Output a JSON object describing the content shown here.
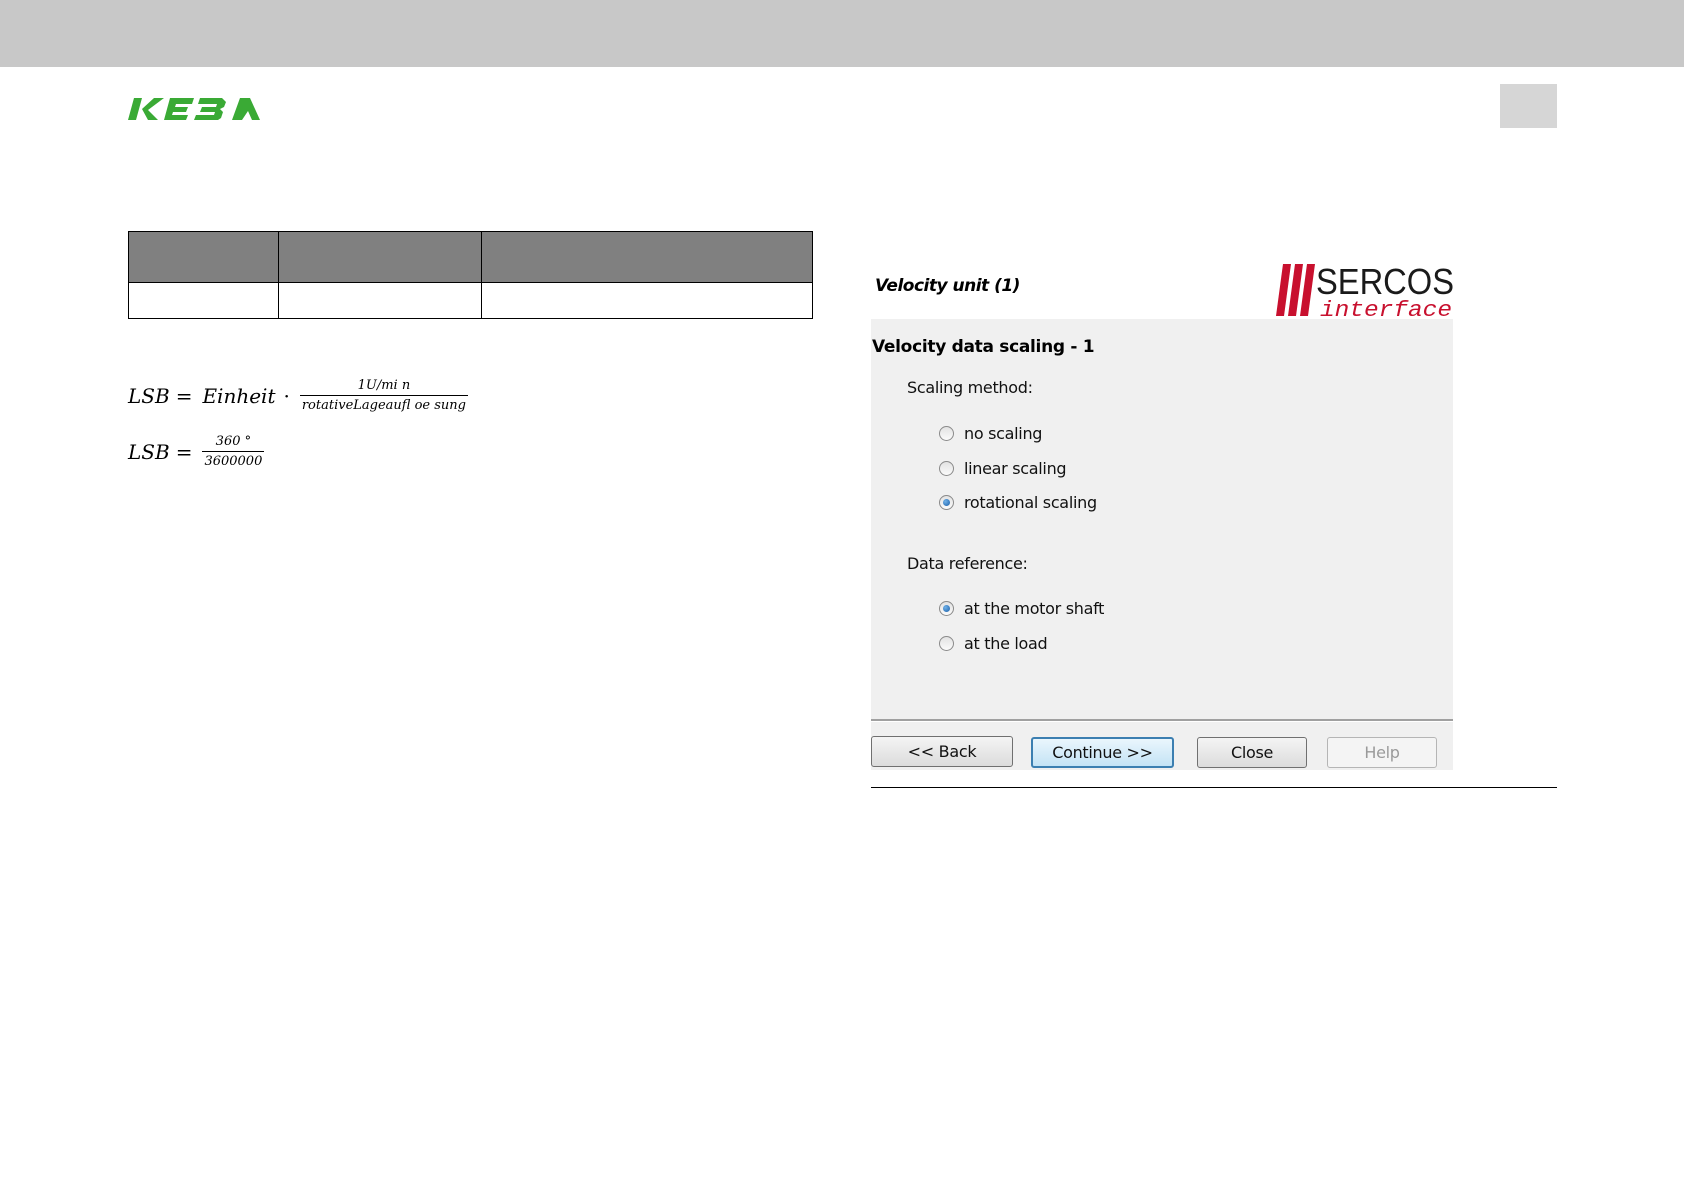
{
  "header": {
    "logo_text": "KEBA"
  },
  "formulas": {
    "f1": {
      "lhs": "LSB",
      "eq": "=",
      "factor": "Einheit",
      "dot": "·",
      "numerator": "1U/mi n",
      "denominator": "rotativeLageaufl oe sung"
    },
    "f2": {
      "lhs": "LSB",
      "eq": "=",
      "numerator": "360 °",
      "denominator": "3600000"
    }
  },
  "dialog": {
    "header_title": "Velocity unit (1)",
    "logo": {
      "brand": "SERCOS",
      "sub": "interface",
      "color": "#c8102e"
    },
    "section_title": "Velocity data scaling - 1",
    "scaling_method": {
      "label": "Scaling method:",
      "options": [
        {
          "label": "no scaling",
          "checked": false
        },
        {
          "label": "linear scaling",
          "checked": false
        },
        {
          "label": "rotational scaling",
          "checked": true
        }
      ]
    },
    "data_reference": {
      "label": "Data reference:",
      "options": [
        {
          "label": "at the motor shaft",
          "checked": true
        },
        {
          "label": "at the load",
          "checked": false
        }
      ]
    },
    "buttons": {
      "back": "<< Back",
      "continue": "Continue >>",
      "close": "Close",
      "help": "Help"
    }
  },
  "colors": {
    "keba_green": "#3aaa35",
    "sercos_red": "#c8102e",
    "table_header": "#808080"
  }
}
